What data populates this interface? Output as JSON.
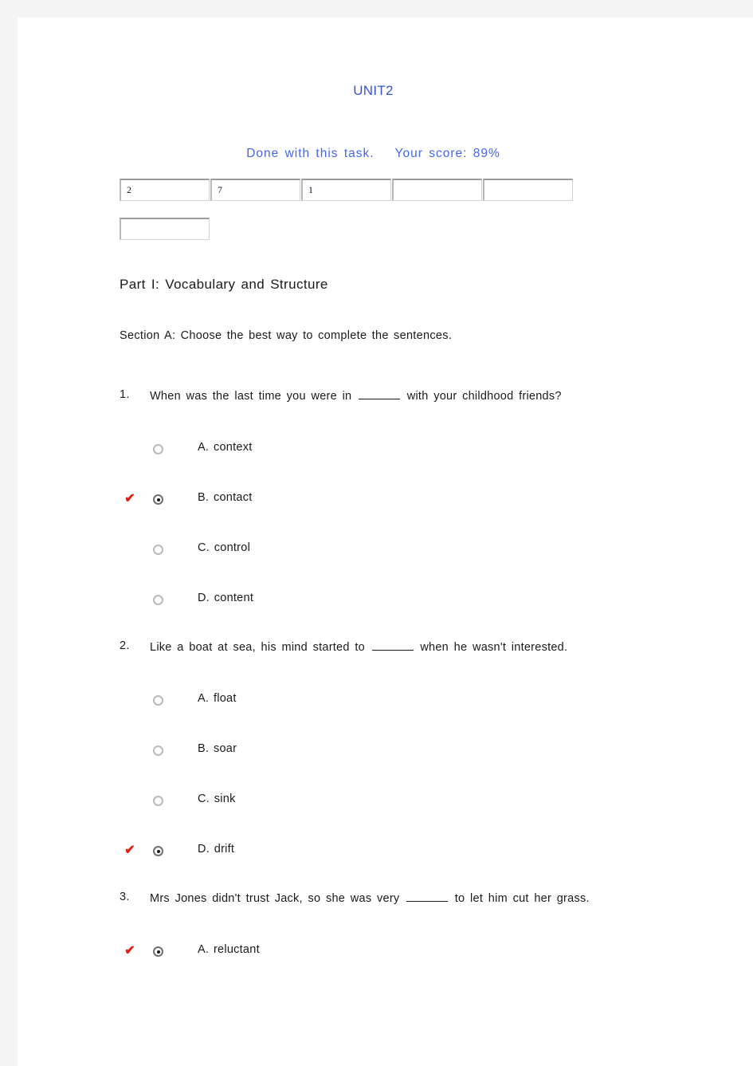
{
  "document": {
    "title": "UNIT2",
    "status_text": "Done with this task.",
    "score_text": "Your score: 89%",
    "title_color": "#3355dd",
    "status_color": "#4466ee",
    "correct_mark_color": "#e01b10",
    "correct_mark_glyph": "✔"
  },
  "answer_boxes": {
    "row1": [
      {
        "value": "2",
        "placeholder": ""
      },
      {
        "value": "7",
        "placeholder": ""
      },
      {
        "value": "1",
        "placeholder": ""
      },
      {
        "value": "",
        "placeholder": ""
      },
      {
        "value": "",
        "placeholder": ""
      }
    ],
    "row2": [
      {
        "value": "",
        "placeholder": ""
      }
    ]
  },
  "part": {
    "heading": "Part I: Vocabulary and Structure",
    "section_heading": "Section A: Choose the best way to complete the sentences."
  },
  "questions": [
    {
      "number": "1.",
      "text_before": "When was the last time you were in",
      "text_after": "with your childhood friends?",
      "options": [
        {
          "label": "A. context",
          "selected": false,
          "correct": false
        },
        {
          "label": "B. contact",
          "selected": true,
          "correct": true
        },
        {
          "label": "C. control",
          "selected": false,
          "correct": false
        },
        {
          "label": "D. content",
          "selected": false,
          "correct": false
        }
      ]
    },
    {
      "number": "2.",
      "text_before": "Like a boat at sea, his mind started to",
      "text_after": "when he wasn't interested.",
      "options": [
        {
          "label": "A. float",
          "selected": false,
          "correct": false
        },
        {
          "label": "B. soar",
          "selected": false,
          "correct": false
        },
        {
          "label": "C. sink",
          "selected": false,
          "correct": false
        },
        {
          "label": "D. drift",
          "selected": true,
          "correct": true
        }
      ]
    },
    {
      "number": "3.",
      "text_before": "Mrs Jones didn't trust Jack, so she was very",
      "text_after": "to let him cut her grass.",
      "options": [
        {
          "label": "A. reluctant",
          "selected": true,
          "correct": true
        }
      ]
    }
  ]
}
